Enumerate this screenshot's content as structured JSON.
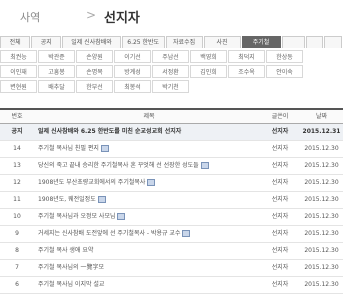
{
  "header": {
    "crumb": "사역",
    "separator": ">",
    "title": "선지자"
  },
  "categories": {
    "row1": [
      "전체",
      "공지",
      "일제 신사참배와",
      "6.25 한반도",
      "자료수집",
      "사진",
      "주기철",
      "",
      "",
      ""
    ],
    "row1_active": 6,
    "row2": [
      "최권능",
      "박관준",
      "손양원",
      "이기선",
      "주남선",
      "백영희",
      "최덕지",
      "한상동"
    ],
    "row3": [
      "이인재",
      "고흥봉",
      "손명복",
      "방계성",
      "서정환",
      "김인희",
      "조수옥",
      "안이숙"
    ],
    "row4": [
      "변현원",
      "배추달",
      "한부선",
      "최봉석",
      "박기천"
    ]
  },
  "table": {
    "headers": {
      "no": "번호",
      "subject": "제목",
      "writer": "글쓴이",
      "date": "날짜"
    },
    "rows": [
      {
        "no": "공지",
        "subject": "일제 신사참배와 6.25 한반도를 미친 순교성교회 선지자",
        "writer": "선지자",
        "date": "2015.12.31",
        "notice": true,
        "icon": false
      },
      {
        "no": "14",
        "subject": "주기철 목사님 친필 편지",
        "writer": "선지자",
        "date": "2015.12.30",
        "notice": false,
        "icon": true
      },
      {
        "no": "13",
        "subject": "당신의 죽고 끝내 승리한 주기철목사 혼 꾸엇해 선 선장한 성도들",
        "writer": "선지자",
        "date": "2015.12.30",
        "notice": false,
        "icon": true
      },
      {
        "no": "12",
        "subject": "1908년도 부산초량교회에서의 주기철목사",
        "writer": "선지자",
        "date": "2015.12.30",
        "notice": false,
        "icon": true
      },
      {
        "no": "11",
        "subject": "1908년도, 웨전일정도",
        "writer": "선지자",
        "date": "2015.12.30",
        "notice": false,
        "icon": true
      },
      {
        "no": "10",
        "subject": "주기철 목사님과 오정모 사모님",
        "writer": "선지자",
        "date": "2015.12.30",
        "notice": false,
        "icon": true
      },
      {
        "no": "9",
        "subject": "거세지는 신사참배 도전앞에 선 주기철목사 - 박용규 교수",
        "writer": "선지자",
        "date": "2015.12.30",
        "notice": false,
        "icon": true
      },
      {
        "no": "8",
        "subject": "주기철 목사 생애 요약",
        "writer": "선지자",
        "date": "2015.12.30",
        "notice": false,
        "icon": false
      },
      {
        "no": "7",
        "subject": "주기철 목사님의 一覽字모",
        "writer": "선지자",
        "date": "2015.12.30",
        "notice": false,
        "icon": false
      },
      {
        "no": "6",
        "subject": "주기철 목사님 이지막 설교",
        "writer": "선지자",
        "date": "2015.12.30",
        "notice": false,
        "icon": false
      }
    ]
  }
}
